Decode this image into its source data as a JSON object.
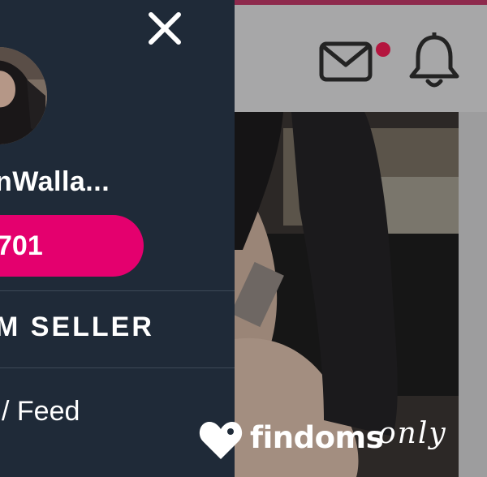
{
  "header": {
    "mail_icon": "mail-icon",
    "bell_icon": "bell-icon",
    "badge_color": "#b4153e"
  },
  "drawer": {
    "close_icon": "close-icon",
    "username": "nWalla...",
    "balance": "701",
    "menu_heading": "M SELLER",
    "menu_item": "/ Feed",
    "accent_color": "#e4006e"
  },
  "watermark": {
    "brand_bold": "findoms",
    "brand_script": "only"
  }
}
